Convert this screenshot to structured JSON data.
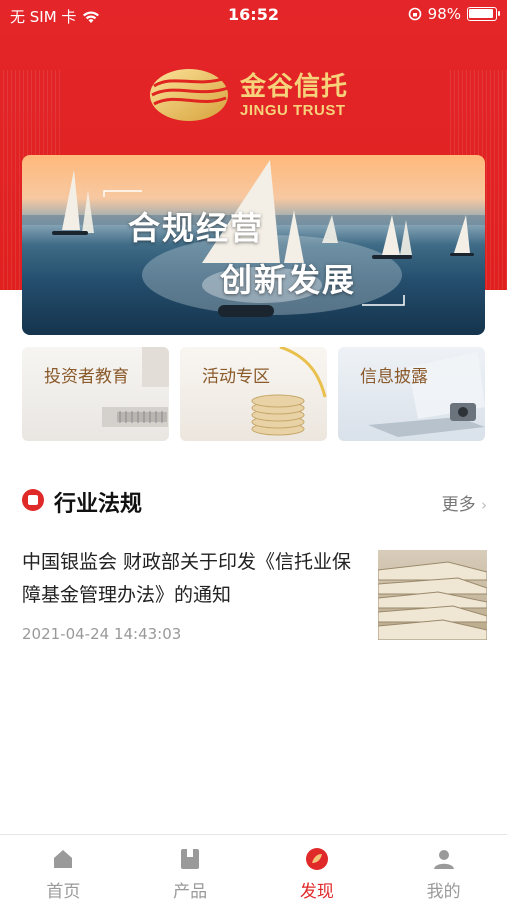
{
  "status_bar": {
    "carrier": "无 SIM 卡",
    "time": "16:52",
    "battery_percent": "98%",
    "icons": [
      "wifi-icon",
      "orientation-lock-icon",
      "battery-icon"
    ]
  },
  "brand": {
    "name_cn": "金谷信托",
    "name_en": "JINGU TRUST",
    "gold": "#f6d27a",
    "red": "#e4262a"
  },
  "banner": {
    "line1": "合规经营",
    "line2": "创新发展"
  },
  "quick_entries": [
    {
      "label": "投资者教育"
    },
    {
      "label": "活动专区"
    },
    {
      "label": "信息披露"
    }
  ],
  "section": {
    "title": "行业法规",
    "more": "更多",
    "icon": "document-icon"
  },
  "news": [
    {
      "title": "中国银监会 财政部关于印发《信托业保障基金管理办法》的通知",
      "date": "2021-04-24 14:43:03"
    }
  ],
  "tabbar": {
    "items": [
      {
        "label": "首页",
        "icon": "home-icon"
      },
      {
        "label": "产品",
        "icon": "product-icon"
      },
      {
        "label": "发现",
        "icon": "discover-icon",
        "active": true
      },
      {
        "label": "我的",
        "icon": "profile-icon"
      }
    ],
    "active_color": "#e02a2a"
  }
}
